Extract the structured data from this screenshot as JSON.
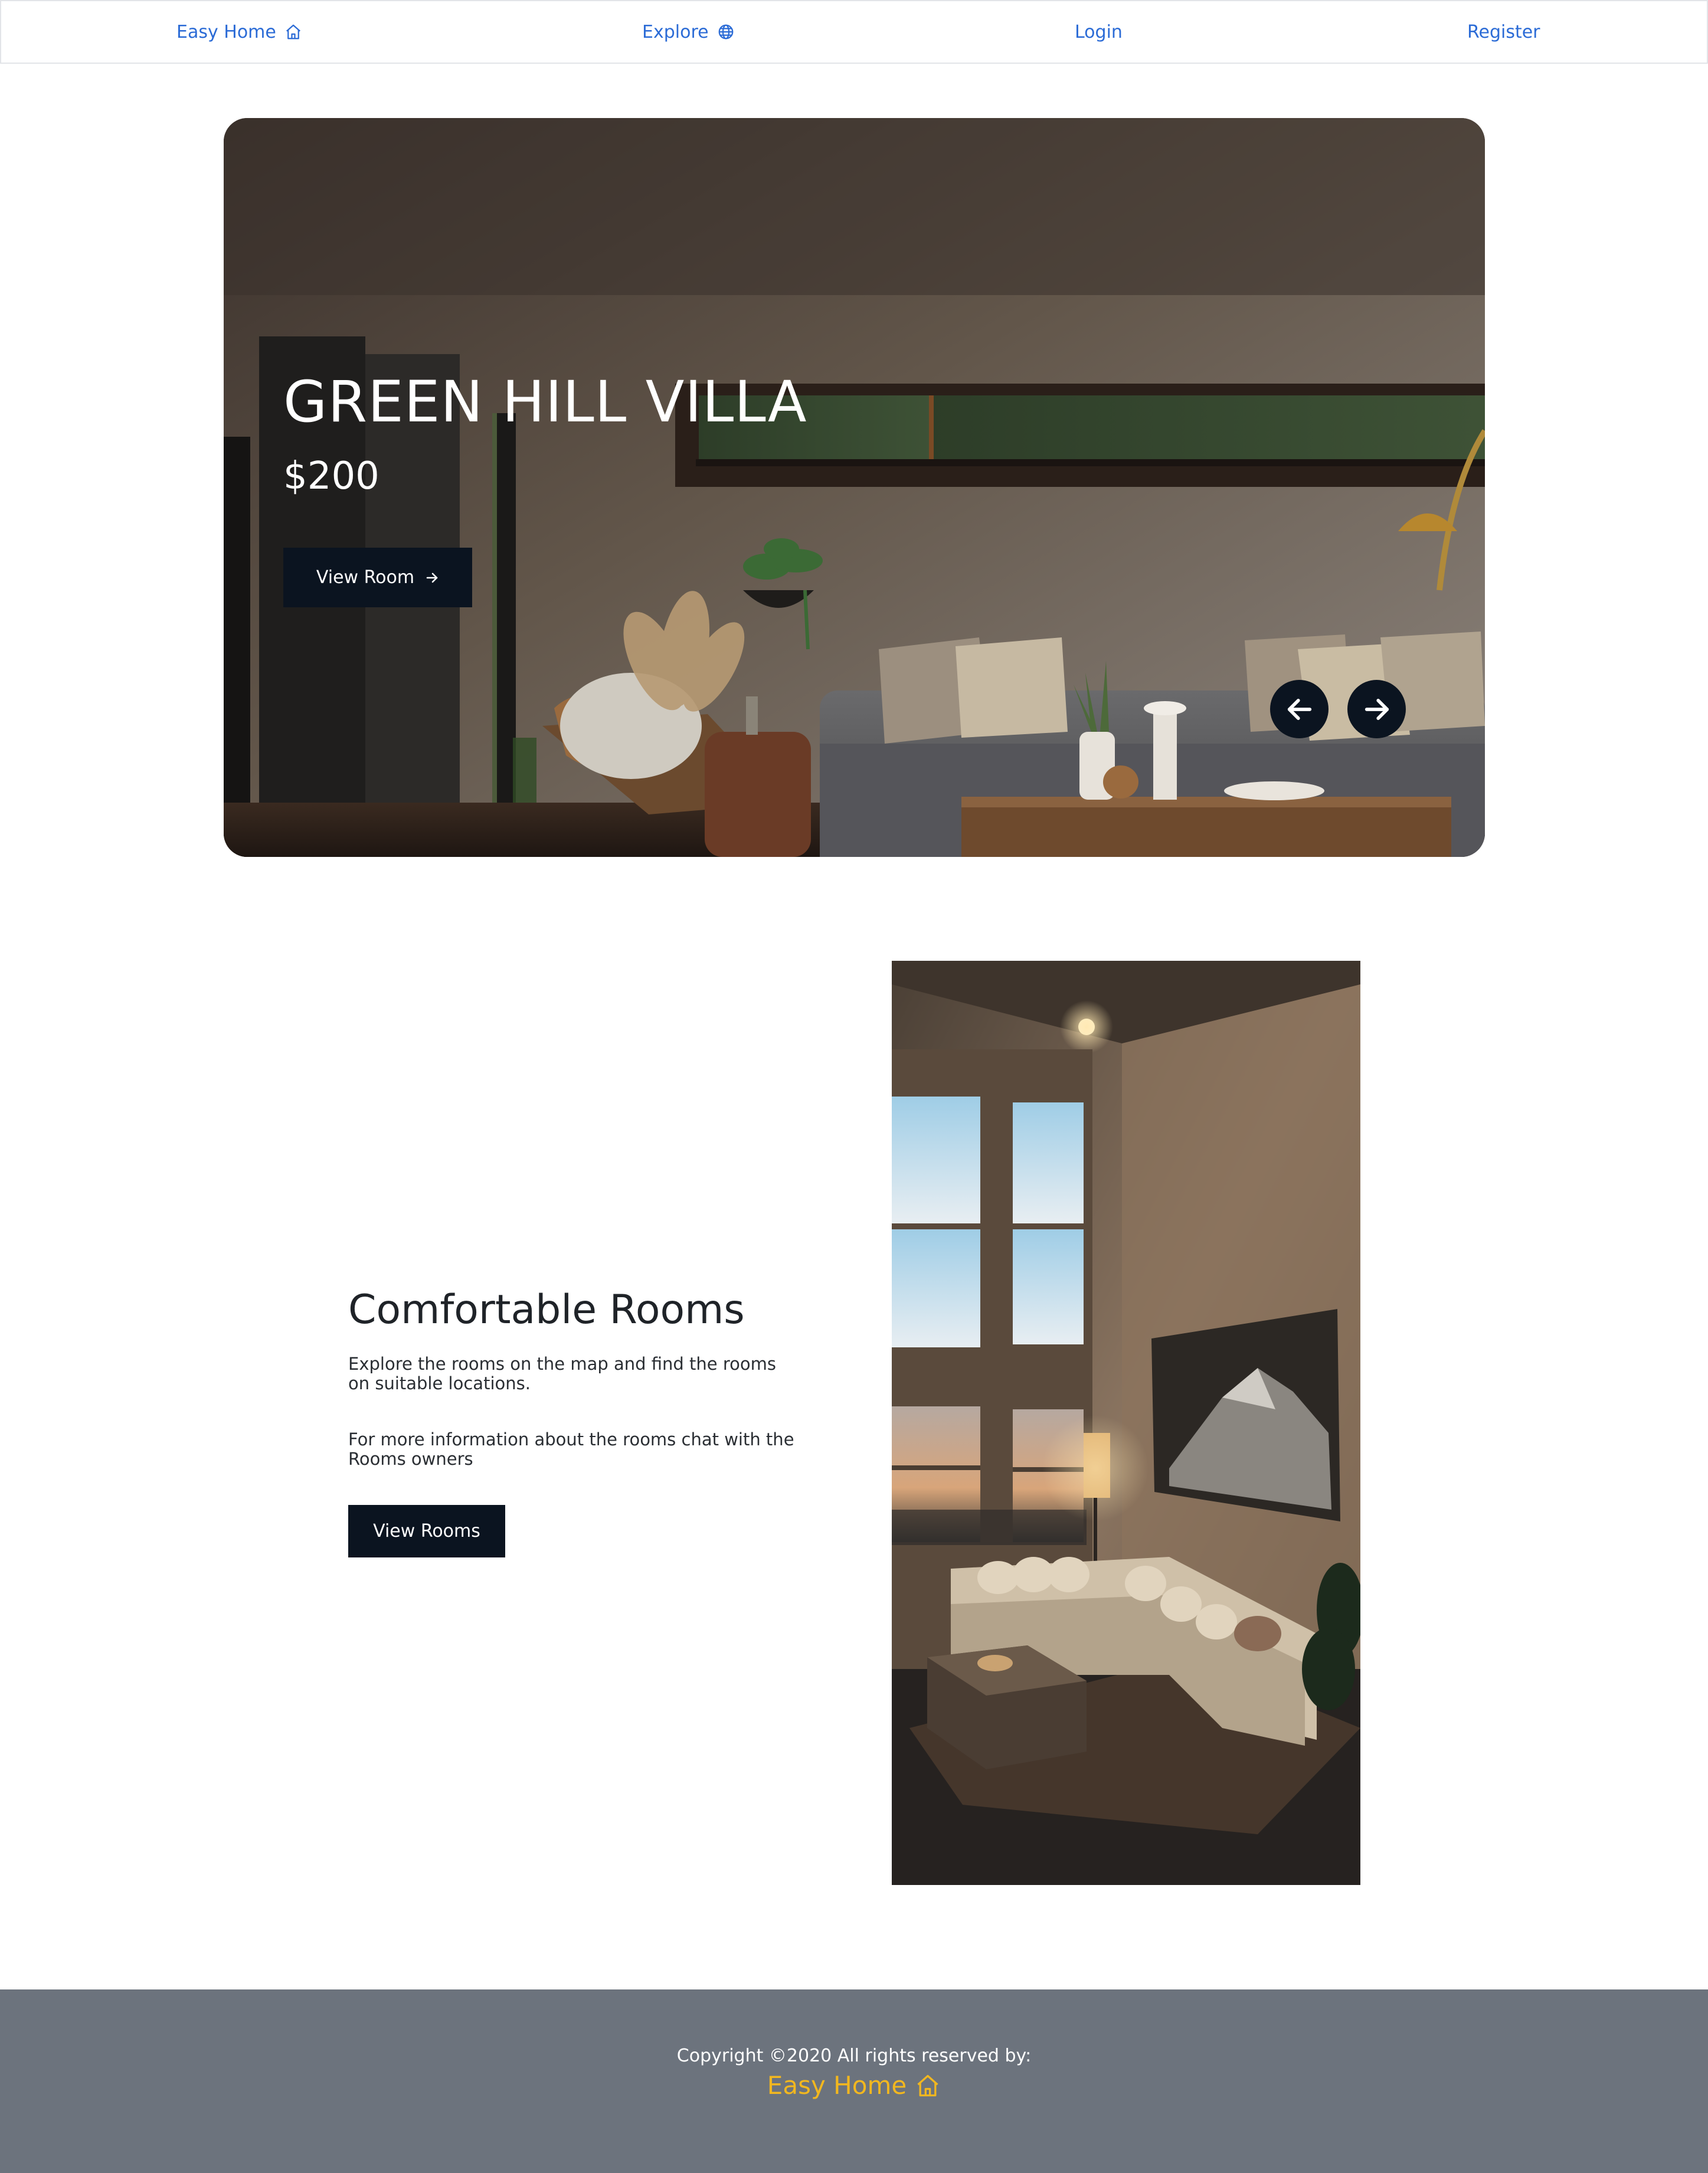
{
  "nav": {
    "home_label": "Easy Home",
    "home_icon": "home-icon",
    "explore_label": "Explore",
    "explore_icon": "globe-icon",
    "login_label": "Login",
    "register_label": "Register",
    "link_color": "#2b6bd6"
  },
  "hero": {
    "title": "GREEN HILL VILLA",
    "price": "$200",
    "button_label": "View Room",
    "button_icon": "arrow-right-icon",
    "prev_icon": "arrow-left-icon",
    "next_icon": "arrow-right-icon",
    "button_color": "#0b1420"
  },
  "feature": {
    "title": "Comfortable Rooms",
    "text_1": "Explore the rooms on the map and find the rooms on suitable locations.",
    "text_2": "For more information about the rooms chat with the Rooms owners",
    "button_label": "View Rooms"
  },
  "footer": {
    "copyright": "Copyright ©2020 All rights reserved by:",
    "brand": "Easy Home",
    "brand_icon": "home-icon",
    "background": "#6c737d",
    "brand_color": "#f2b71f"
  }
}
